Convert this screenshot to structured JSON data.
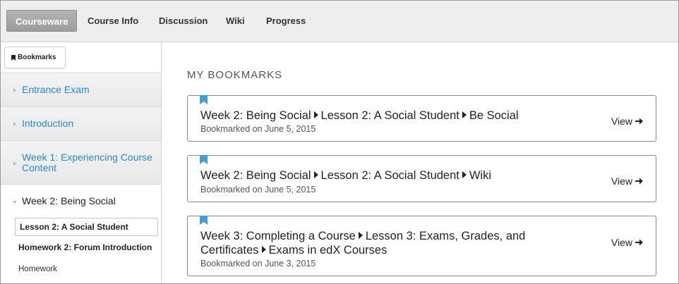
{
  "tabs": [
    {
      "label": "Courseware",
      "active": true
    },
    {
      "label": "Course Info",
      "active": false
    },
    {
      "label": "Discussion",
      "active": false
    },
    {
      "label": "Wiki",
      "active": false
    },
    {
      "label": "Progress",
      "active": false
    }
  ],
  "sidebar": {
    "bookmarks_button": {
      "label": "Bookmarks",
      "icon": "bookmark-icon"
    },
    "chapters": [
      {
        "label": "Entrance Exam",
        "expanded": false
      },
      {
        "label": "Introduction",
        "expanded": false
      },
      {
        "label": "Week 1: Experiencing Course Content",
        "expanded": false
      },
      {
        "label": "Week 2: Being Social",
        "expanded": true
      }
    ],
    "current_sequence": "Lesson 2: A Social Student",
    "sequence_item": {
      "title": "Homework 2: Forum Introduction",
      "subtitle": "Homework"
    }
  },
  "main": {
    "title": "MY BOOKMARKS",
    "bookmarks": [
      {
        "path": [
          "Week 2: Being Social",
          "Lesson 2: A Social Student",
          "Be Social"
        ],
        "date": "Bookmarked on June 5, 2015",
        "view_label": "View"
      },
      {
        "path": [
          "Week 2: Being Social",
          "Lesson 2: A Social Student",
          "Wiki"
        ],
        "date": "Bookmarked on June 5, 2015",
        "view_label": "View"
      },
      {
        "path": [
          "Week 3: Completing a Course",
          "Lesson 3: Exams, Grades, and Certificates",
          "Exams in edX Courses"
        ],
        "date": "Bookmarked on June 3, 2015",
        "view_label": "View"
      }
    ]
  },
  "colors": {
    "link_blue": "#2a89c9",
    "bookmark_flag": "#3aa0e0",
    "tab_bar_bg": "#eeeeee",
    "active_tab_bg": "#a8a8a8"
  }
}
